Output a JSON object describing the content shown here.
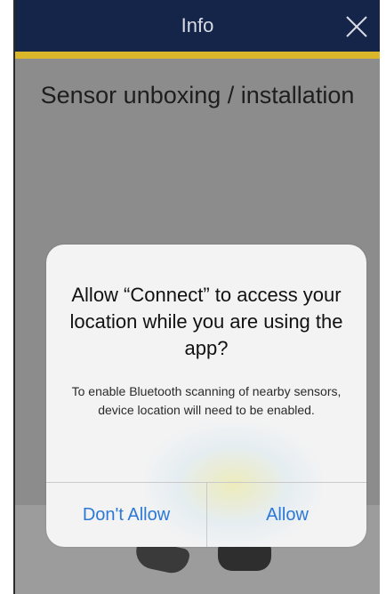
{
  "nav": {
    "title": "Info"
  },
  "page": {
    "heading": "Sensor unboxing / installation"
  },
  "alert": {
    "title": "Allow “Connect” to access your location while you are using the app?",
    "message": "To enable Bluetooth scanning of nearby sensors, device location will need to be enabled.",
    "deny_label": "Don't Allow",
    "allow_label": "Allow"
  },
  "colors": {
    "nav_background": "#15254a",
    "nav_accent": "#d9b62a",
    "button_text": "#2b78d6",
    "overlay": "#8c8c8c"
  },
  "icons": {
    "close": "close-icon"
  }
}
